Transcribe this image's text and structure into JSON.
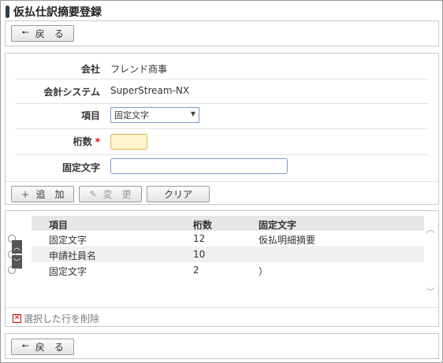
{
  "page": {
    "title": "仮払仕訳摘要登録"
  },
  "back_label": "戻　る",
  "form": {
    "company_label": "会社",
    "company_value": "フレンド商事",
    "system_label": "会計システム",
    "system_value": "SuperStream-NX",
    "item_label": "項目",
    "item_value": "固定文字",
    "digits_label": "桁数",
    "digits_required": "*",
    "fixed_text_label": "固定文字"
  },
  "actions": {
    "add": "追　加",
    "change": "変　更",
    "clear": "クリア"
  },
  "grid": {
    "headers": [
      "項目",
      "桁数",
      "固定文字"
    ],
    "rows": [
      {
        "item": "固定文字",
        "digits": "12",
        "text": "仮払明細摘要"
      },
      {
        "item": "申請社員名",
        "digits": "10",
        "text": ""
      },
      {
        "item": "固定文字",
        "digits": "2",
        "text": "）"
      }
    ],
    "delete_label": "選択した行を削除"
  },
  "icons": {
    "back": "arrow-left-icon",
    "add": "plus-icon",
    "change": "pencil-icon",
    "up": "chevron-up-icon",
    "down": "chevron-down-icon",
    "delete": "x-box-icon"
  },
  "colors": {
    "required": "#dd0000",
    "digits_bg": "#fff4cc",
    "title_mark": "#2e3b4e"
  }
}
